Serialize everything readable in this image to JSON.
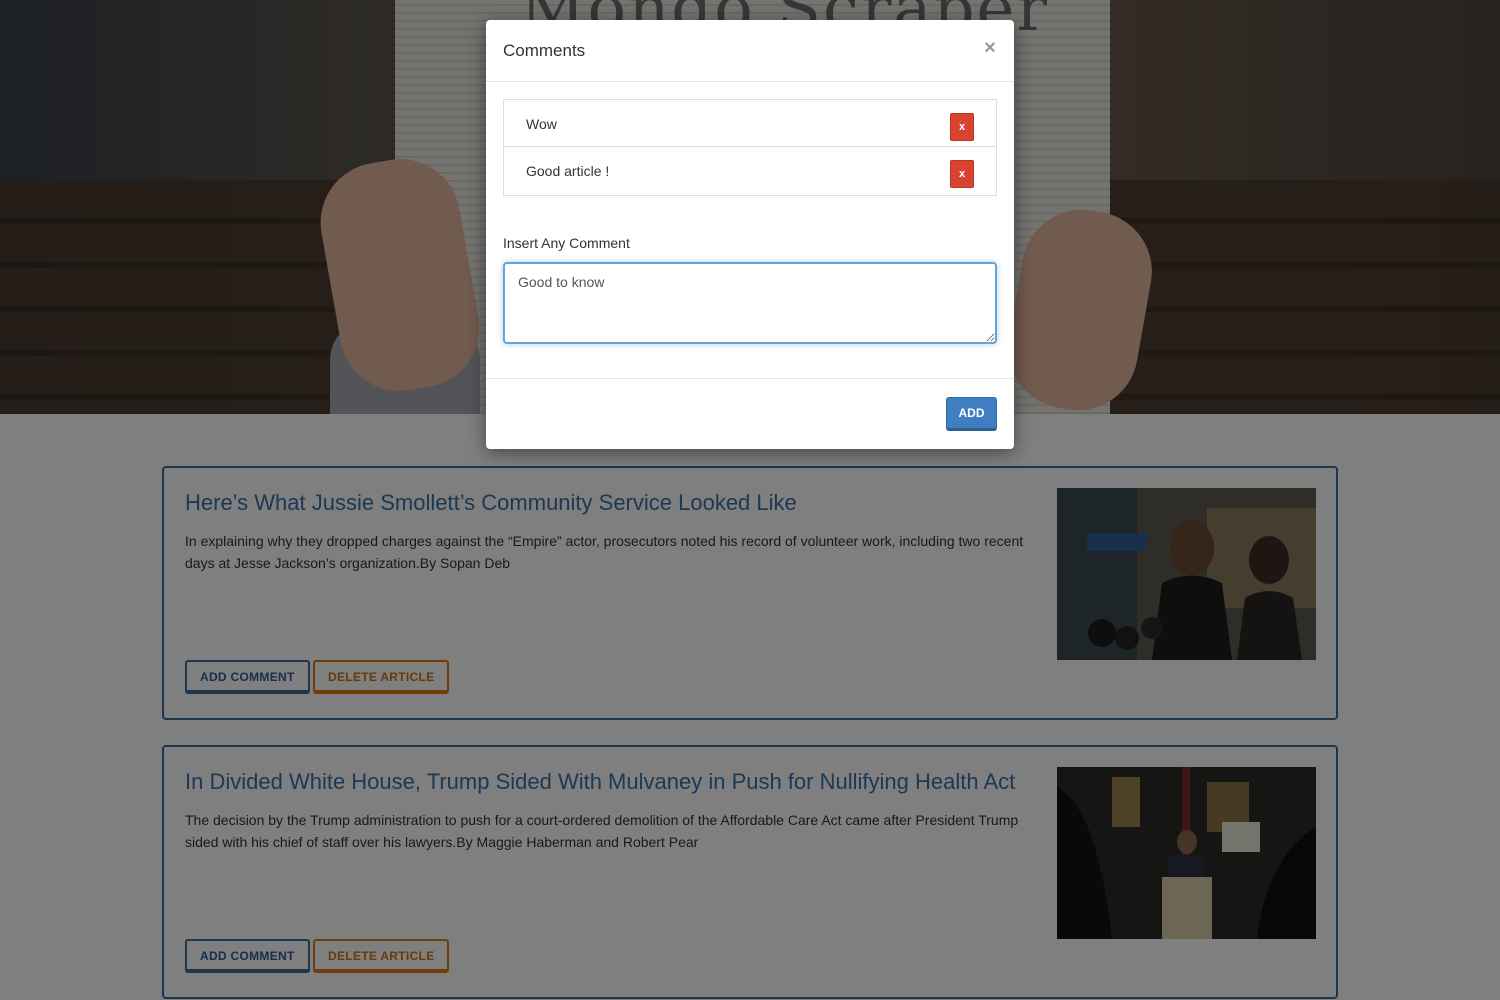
{
  "hero": {
    "masthead_text": "Mongo Scraper"
  },
  "articles": [
    {
      "title": "Here’s What Jussie Smollett’s Community Service Looked Like",
      "summary": "In explaining why they dropped charges against the “Empire” actor, prosecutors noted his record of volunteer work, including two recent days at Jesse Jackson’s organization.By Sopan Deb",
      "add_comment_label": "ADD COMMENT",
      "delete_label": "DELETE ARTICLE"
    },
    {
      "title": "In Divided White House, Trump Sided With Mulvaney in Push for Nullifying Health Act",
      "summary": "The decision by the Trump administration to push for a court-ordered demolition of the Affordable Care Act came after President Trump sided with his chief of staff over his lawyers.By Maggie Haberman and Robert Pear",
      "add_comment_label": "ADD COMMENT",
      "delete_label": "DELETE ARTICLE"
    }
  ],
  "modal": {
    "title": "Comments",
    "close_icon": "×",
    "comments": [
      {
        "text": "Wow",
        "delete_label": "x"
      },
      {
        "text": "Good article !",
        "delete_label": "x"
      }
    ],
    "insert_label": "Insert Any Comment",
    "input_value": "Good to know",
    "add_label": "ADD"
  },
  "colors": {
    "primary": "#3f7ec0",
    "danger": "#d9432f",
    "warning": "#e07d1a",
    "article_border": "#3f6b99"
  }
}
